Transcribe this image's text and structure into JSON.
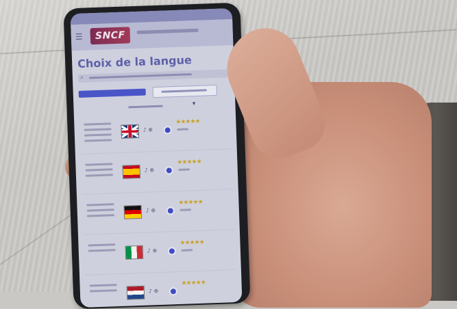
{
  "app": {
    "logo_text": "SNCF",
    "brand_color": "#a23a58"
  },
  "screen": {
    "title": "Choix de la langue",
    "accent": "#4a55c8"
  },
  "languages": [
    {
      "flag": "uk-flag",
      "stars": "★★★★★"
    },
    {
      "flag": "spain-flag",
      "stars": "★★★★★"
    },
    {
      "flag": "germany-flag",
      "stars": "★★★★★"
    },
    {
      "flag": "italy-flag",
      "stars": "★★★★★"
    },
    {
      "flag": "netherlands-flag",
      "stars": "★★★★★"
    }
  ]
}
